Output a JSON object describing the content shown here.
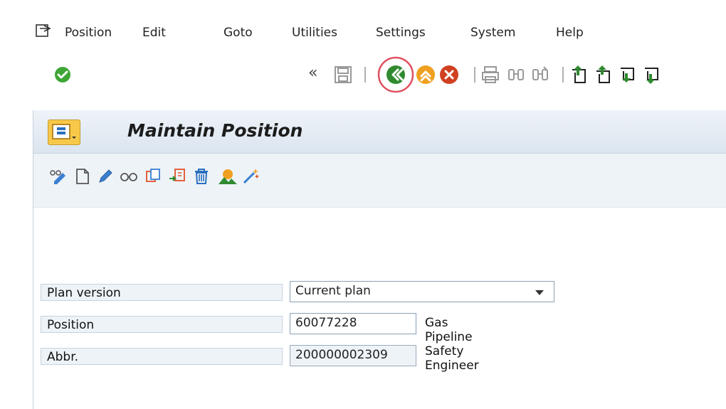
{
  "menubar": {
    "items": [
      "Position",
      "Edit",
      "Goto",
      "Utilities",
      "Settings",
      "System",
      "Help"
    ]
  },
  "toolbar": {
    "command_field": {
      "value": ""
    },
    "icons": [
      "enter-icon",
      "back-double-chevron-icon",
      "save-icon",
      "back-icon",
      "exit-icon",
      "cancel-icon",
      "print-icon",
      "find-icon",
      "find-next-icon",
      "first-page-icon",
      "previous-page-icon",
      "next-page-icon",
      "last-page-icon"
    ],
    "highlighted_icon": "back-icon",
    "highlight_color": "#e05060"
  },
  "screen": {
    "title": "Maintain Position",
    "app_toolbar_icons": [
      "display-info-icon",
      "create-icon",
      "change-icon",
      "display-icon",
      "copy-icon",
      "delimit-icon",
      "delete-icon",
      "overview-icon",
      "wizard-icon"
    ]
  },
  "form": {
    "plan_version": {
      "label": "Plan version",
      "value": "Current plan"
    },
    "position": {
      "label": "Position",
      "value": "60077228",
      "description": "Gas Pipeline Safety Engineer"
    },
    "abbr": {
      "label": "Abbr.",
      "value": "200000002309"
    }
  },
  "colors": {
    "enter_green": "#3fa535",
    "back_green": "#2f8a2f",
    "exit_orange": "#f0a020",
    "cancel_red": "#d04020",
    "title_bar": "#dbe5ef",
    "title_icon": "#f7c94a"
  }
}
